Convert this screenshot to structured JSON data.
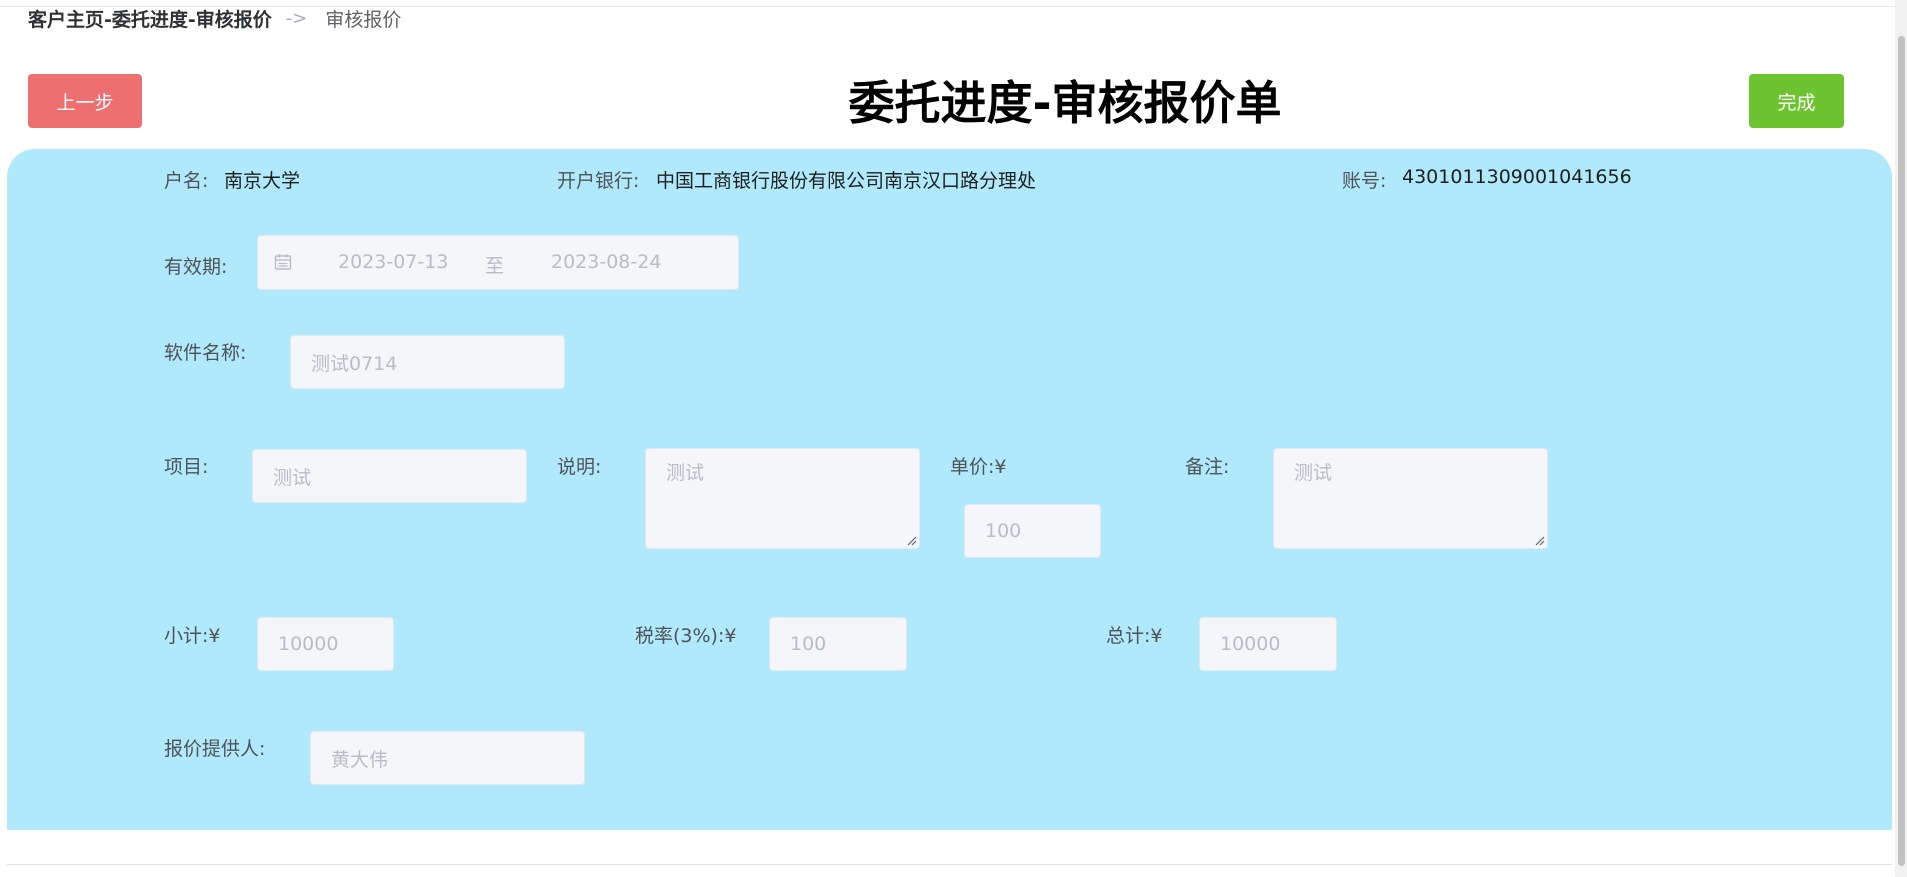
{
  "breadcrumb": {
    "root": "客户主页-委托进度-审核报价",
    "separator": "->",
    "current": "审核报价"
  },
  "header": {
    "back_label": "上一步",
    "title": "委托进度-审核报价单",
    "done_label": "完成"
  },
  "account": {
    "name_label": "户名:",
    "name_value": "南京大学",
    "bank_label": "开户银行:",
    "bank_value": "中国工商银行股份有限公司南京汉口路分理处",
    "number_label": "账号:",
    "number_value": "4301011309001041656"
  },
  "validity": {
    "label": "有效期:",
    "start": "2023-07-13",
    "separator": "至",
    "end": "2023-08-24",
    "icon": "calendar-icon"
  },
  "software": {
    "label": "软件名称:",
    "value": "测试0714"
  },
  "item_row": {
    "item_label": "项目:",
    "item_value": "测试",
    "desc_label": "说明:",
    "desc_value": "测试",
    "price_label": "单价:¥",
    "price_value": "100",
    "note_label": "备注:",
    "note_value": "测试"
  },
  "totals": {
    "subtotal_label": "小计:¥",
    "subtotal_value": "10000",
    "tax_label": "税率(3%):¥",
    "tax_value": "100",
    "total_label": "总计:¥",
    "total_value": "10000"
  },
  "provider": {
    "label": "报价提供人:",
    "value": "黄大伟"
  },
  "colors": {
    "back_button": "#ed6f6f",
    "done_button": "#6ec330",
    "panel_background": "#afe9fb",
    "input_background": "#f4f6fa"
  }
}
